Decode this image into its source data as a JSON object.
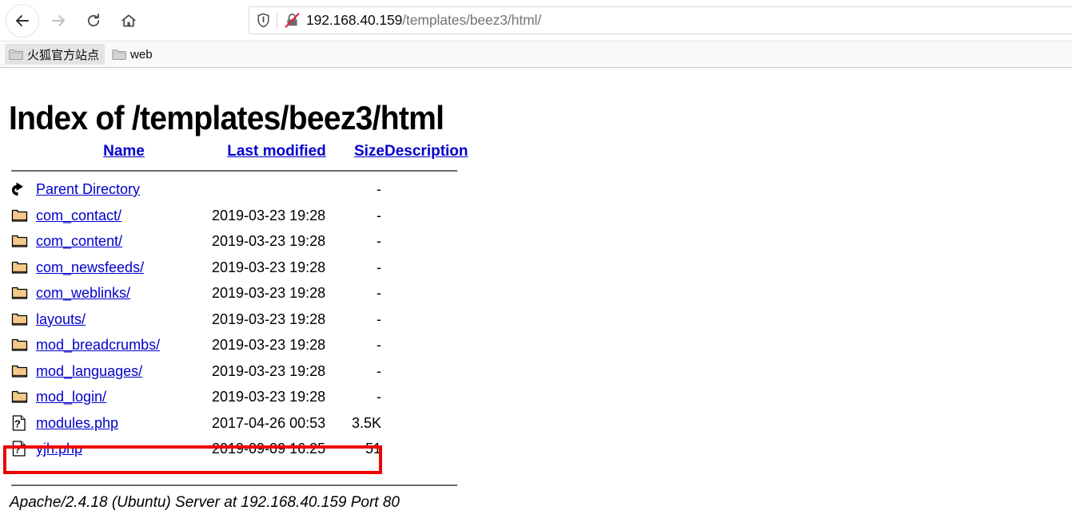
{
  "browser": {
    "nav": {
      "back_label": "Back",
      "back_icon": "arrow-left-icon",
      "forward_label": "Forward",
      "forward_icon": "arrow-right-icon",
      "reload_label": "Reload",
      "reload_icon": "reload-icon",
      "home_label": "Home",
      "home_icon": "home-icon"
    },
    "urlbar": {
      "shield_icon": "shield-icon",
      "security_icon": "lock-crossed-out-icon",
      "host": "192.168.40.159",
      "path": "/templates/beez3/html/",
      "full_url": "192.168.40.159/templates/beez3/html/"
    },
    "bookmarks": [
      {
        "label": "火狐官方站点",
        "icon": "folder-icon",
        "active": true
      },
      {
        "label": "web",
        "icon": "folder-icon",
        "active": false
      }
    ]
  },
  "page": {
    "title": "Index of /templates/beez3/html",
    "columns": {
      "name": "Name",
      "last_modified": "Last modified",
      "size": "Size",
      "description": "Description"
    },
    "entries": [
      {
        "icon": "back-arrow-icon",
        "name": "Parent Directory",
        "date": "",
        "size": "-",
        "description": "",
        "highlighted": false
      },
      {
        "icon": "folder-icon",
        "name": "com_contact/",
        "date": "2019-03-23 19:28",
        "size": "-",
        "description": "",
        "highlighted": false
      },
      {
        "icon": "folder-icon",
        "name": "com_content/",
        "date": "2019-03-23 19:28",
        "size": "-",
        "description": "",
        "highlighted": false
      },
      {
        "icon": "folder-icon",
        "name": "com_newsfeeds/",
        "date": "2019-03-23 19:28",
        "size": "-",
        "description": "",
        "highlighted": false
      },
      {
        "icon": "folder-icon",
        "name": "com_weblinks/",
        "date": "2019-03-23 19:28",
        "size": "-",
        "description": "",
        "highlighted": false
      },
      {
        "icon": "folder-icon",
        "name": "layouts/",
        "date": "2019-03-23 19:28",
        "size": "-",
        "description": "",
        "highlighted": false
      },
      {
        "icon": "folder-icon",
        "name": "mod_breadcrumbs/",
        "date": "2019-03-23 19:28",
        "size": "-",
        "description": "",
        "highlighted": false
      },
      {
        "icon": "folder-icon",
        "name": "mod_languages/",
        "date": "2019-03-23 19:28",
        "size": "-",
        "description": "",
        "highlighted": false
      },
      {
        "icon": "folder-icon",
        "name": "mod_login/",
        "date": "2019-03-23 19:28",
        "size": "-",
        "description": "",
        "highlighted": false
      },
      {
        "icon": "unknown-file-icon",
        "name": "modules.php",
        "date": "2017-04-26 00:53",
        "size": "3.5K",
        "description": "",
        "highlighted": false
      },
      {
        "icon": "unknown-file-icon",
        "name": "yjh.php",
        "date": "2019-09-09 16:25",
        "size": "51",
        "description": "",
        "highlighted": true
      }
    ],
    "footer": "Apache/2.4.18 (Ubuntu) Server at 192.168.40.159 Port 80"
  },
  "colors": {
    "link": "#0000cc",
    "highlight": "#ee0000",
    "rule": "#6b6b6b",
    "folder_fill": "#f5c98a",
    "chrome_bg": "#f9f9fa"
  }
}
